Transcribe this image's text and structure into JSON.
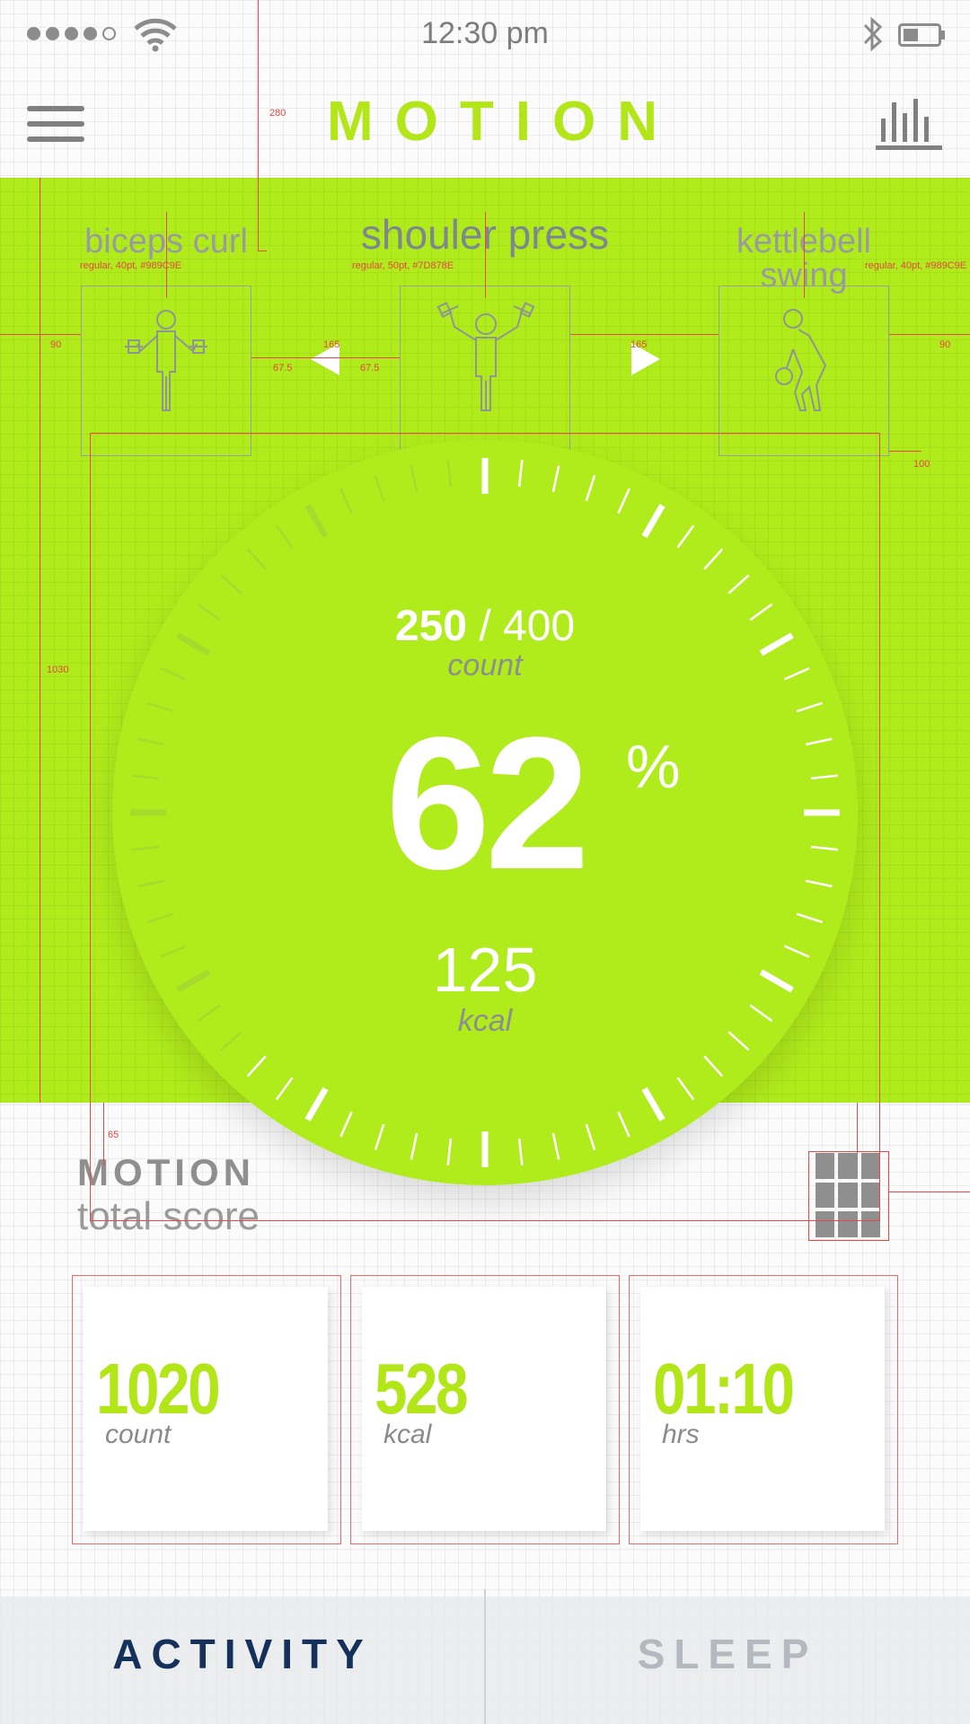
{
  "status_bar": {
    "time": "12:30 pm",
    "signal_bars_filled": 4,
    "signal_bars_total": 5,
    "icons": [
      "wifi-icon",
      "bluetooth-icon",
      "battery-icon"
    ]
  },
  "header": {
    "title": "MOTION",
    "menu_icon": "hamburger-icon",
    "stats_icon": "bar-chart-icon"
  },
  "exercises": {
    "previous": {
      "label": "biceps curl",
      "spec": "regular, 40pt, #989C9E",
      "icon": "biceps-curl-icon"
    },
    "current": {
      "label": "shouler press",
      "spec": "regular, 50pt, #7D878E",
      "icon": "shoulder-press-icon"
    },
    "next": {
      "label": "kettlebell swing",
      "spec": "regular, 40pt, #989C9E",
      "icon": "kettlebell-swing-icon"
    }
  },
  "dial": {
    "count_done": "250",
    "count_separator": "/",
    "count_total": "400",
    "count_unit": "count",
    "percent": "62",
    "percent_sign": "%",
    "kcal": "125",
    "kcal_unit": "kcal",
    "progress": 0.62
  },
  "total_score": {
    "title": "MOTION",
    "subtitle": "total score",
    "grid_icon": "grid-icon"
  },
  "cards": [
    {
      "value": "1020",
      "unit": "count"
    },
    {
      "value": "528",
      "unit": "kcal"
    },
    {
      "value": "01:10",
      "unit": "hrs"
    }
  ],
  "annotations": {
    "a280": "280",
    "a90_left": "90",
    "a90_right": "90",
    "a165_left": "165",
    "a165_right": "165",
    "a67_left": "67.5",
    "a67_right": "67.5",
    "a100": "100",
    "a1030": "1030",
    "a65": "65"
  },
  "tabs": [
    {
      "label": "ACTIVITY",
      "active": true
    },
    {
      "label": "SLEEP",
      "active": false
    }
  ],
  "colors": {
    "accent": "#B0EC1C",
    "label_gray": "#989C9E",
    "current_label": "#7D878E",
    "tab_active": "#15305A",
    "guide_red": "#E84848"
  }
}
